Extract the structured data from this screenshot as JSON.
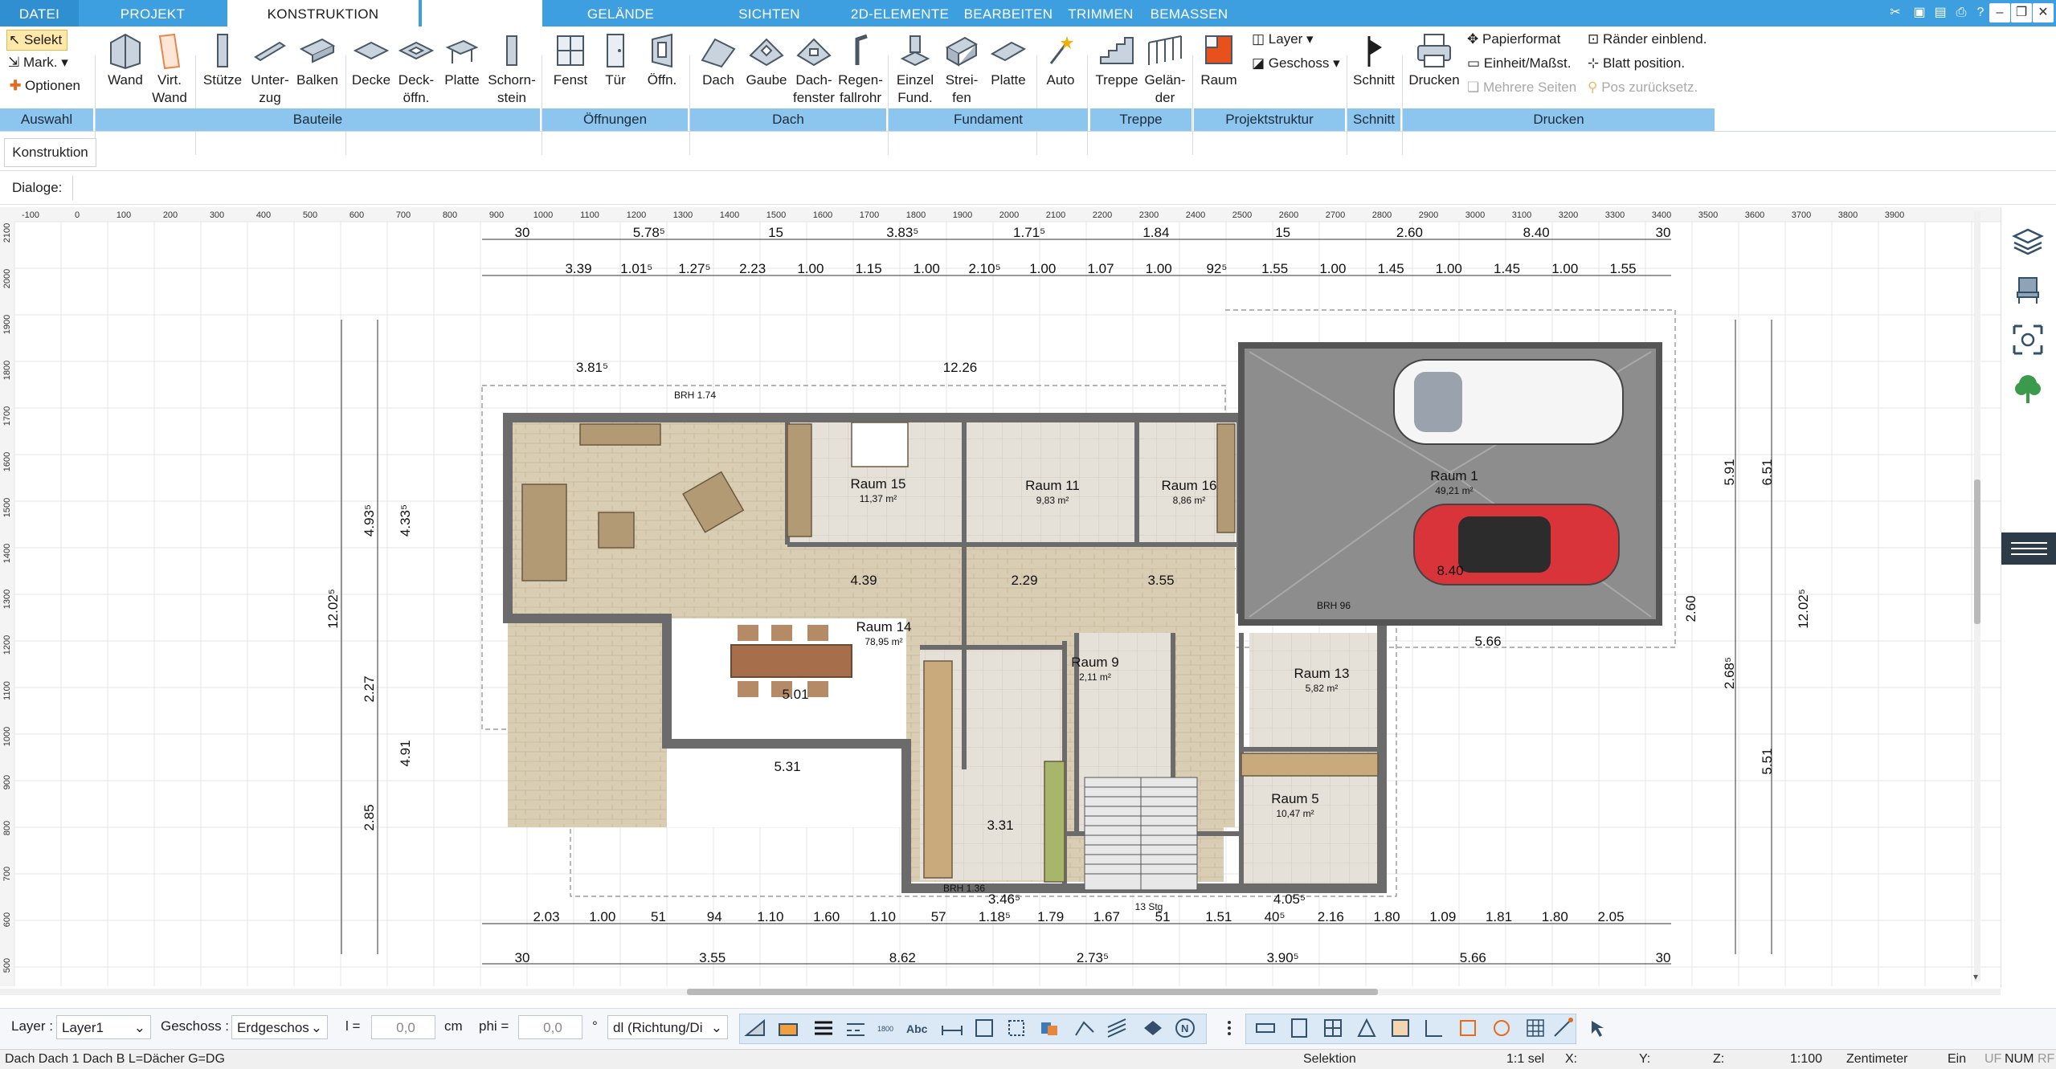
{
  "tabs": {
    "datei": "DATEI",
    "projekt": "PROJEKT",
    "konstruktion": "KONSTRUKTION",
    "gelaende": "GELÄNDE",
    "sichten": "SICHTEN",
    "elemente2d": "2D-ELEMENTE",
    "bearbeiten": "BEARBEITEN",
    "trimmen": "TRIMMEN",
    "bemassen": "BEMASSEN"
  },
  "ribbon": {
    "selekt": "Selekt",
    "mark": "Mark.",
    "optionen": "Optionen",
    "wand": "Wand",
    "virt_wand_1": "Virt.",
    "virt_wand_2": "Wand",
    "stuetze": "Stütze",
    "unterzug_1": "Unter-",
    "unterzug_2": "zug",
    "balken": "Balken",
    "decke": "Decke",
    "deckoeffn_1": "Deck-",
    "deckoeffn_2": "öffn.",
    "platte": "Platte",
    "schornstein_1": "Schorn-",
    "schornstein_2": "stein",
    "fenst": "Fenst",
    "tuer": "Tür",
    "oeffn": "Öffn.",
    "dach": "Dach",
    "gaube": "Gaube",
    "dachfenster_1": "Dach-",
    "dachfenster_2": "fenster",
    "regenfallrohr_1": "Regen-",
    "regenfallrohr_2": "fallrohr",
    "einzel_1": "Einzel",
    "einzel_2": "Fund.",
    "streifen_1": "Strei-",
    "streifen_2": "fen",
    "fund_platte": "Platte",
    "auto": "Auto",
    "treppe": "Treppe",
    "gelaender_1": "Gelän-",
    "gelaender_2": "der",
    "layer": "Layer",
    "geschoss": "Geschoss",
    "raum": "Raum",
    "schnitt": "Schnitt",
    "drucken": "Drucken",
    "papierformat": "Papierformat",
    "einheit": "Einheit/Maßst.",
    "mehrere_seiten": "Mehrere Seiten",
    "raender": "Ränder einblend.",
    "blatt": "Blatt position.",
    "pos_zurueck": "Pos zurücksetz."
  },
  "groups": {
    "auswahl": "Auswahl",
    "bauteile": "Bauteile",
    "oeffnungen": "Öffnungen",
    "dach": "Dach",
    "fundament": "Fundament",
    "treppe": "Treppe",
    "projektstruktur": "Projektstruktur",
    "schnitt": "Schnitt",
    "drucken": "Drucken"
  },
  "panel": {
    "konstruktion_tab": "Konstruktion",
    "dialoge": "Dialoge:"
  },
  "plan": {
    "rooms": [
      {
        "name": "Raum 1",
        "area": "49,21 m²"
      },
      {
        "name": "Raum 14",
        "area": "78,95 m²"
      },
      {
        "name": "Raum 15",
        "area": "11,37 m²"
      },
      {
        "name": "Raum 11",
        "area": "9,83 m²"
      },
      {
        "name": "Raum 16",
        "area": "8,86 m²"
      },
      {
        "name": "Raum 9",
        "area": "2,11 m²"
      },
      {
        "name": "Raum 13",
        "area": "5,82 m²"
      },
      {
        "name": "Raum 5",
        "area": "10,47 m²"
      }
    ],
    "top_dims_row1": [
      "30",
      "5.78⁵",
      "15",
      "3.83⁵",
      "1.71⁵",
      "1.84",
      "15",
      "2.60",
      "8.40",
      "30"
    ],
    "top_dims_row2": [
      "3.39",
      "1.01⁵",
      "1.27⁵",
      "2.23",
      "1.00",
      "1.15",
      "1.00",
      "2.10⁵",
      "1.00",
      "1.07",
      "1.00",
      "92⁵",
      "1.55",
      "1.00",
      "1.45",
      "1.00",
      "1.45",
      "1.00",
      "1.55"
    ],
    "bottom_dims_row1": [
      "2.03",
      "1.00",
      "51",
      "94",
      "1.10",
      "1.60",
      "1.10",
      "57",
      "1.18⁵",
      "1.79",
      "1.67",
      "51",
      "1.51",
      "40⁵",
      "2.16",
      "1.80",
      "1.09",
      "1.81",
      "1.80",
      "2.05"
    ],
    "bottom_dims_row2": [
      "30",
      "3.55",
      "8.62",
      "2.73⁵",
      "3.90⁵",
      "5.66",
      "30"
    ],
    "left_dims": [
      "12.02⁵",
      "4.93⁵",
      "4.33⁵",
      "2.27",
      "4.91",
      "2.85"
    ],
    "right_dims": [
      "12.02⁵",
      "5.91",
      "6.51",
      "5.51",
      "2.60",
      "2.68⁵"
    ],
    "inner_labels": [
      "12.26",
      "3.81⁵",
      "4.39",
      "2.29",
      "3.55",
      "5.31",
      "3.31",
      "5.66",
      "5.01",
      "8.40",
      "BRH 1.74",
      "BRH 96",
      "BRH 1.36",
      "3.46⁵",
      "4.05⁵",
      "13 Stg"
    ],
    "ruler_x": [
      "-100",
      "0",
      "100",
      "200",
      "300",
      "400",
      "500",
      "600",
      "700",
      "800",
      "900",
      "1000",
      "1100",
      "1200",
      "1300",
      "1400",
      "1500",
      "1600",
      "1700",
      "1800",
      "1900",
      "2000",
      "2100",
      "2200",
      "2300",
      "2400",
      "2500",
      "2600",
      "2700",
      "2800",
      "2900",
      "3000",
      "3100",
      "3200",
      "3300",
      "3400",
      "3500",
      "3600",
      "3700",
      "3800",
      "3900"
    ],
    "ruler_y": [
      "2100",
      "2000",
      "1900",
      "1800",
      "1700",
      "1600",
      "1500",
      "1400",
      "1300",
      "1200",
      "1100",
      "1000",
      "900",
      "800",
      "700",
      "600",
      "500"
    ]
  },
  "bottombar": {
    "layer_label": "Layer :",
    "layer_value": "Layer1",
    "geschoss_label": "Geschoss :",
    "geschoss_value": "Erdgeschos",
    "l_label": "l =",
    "l_value": "0,0",
    "cm": "cm",
    "phi_label": "phi =",
    "phi_value": "0,0",
    "deg": "°",
    "dl_value": "dl (Richtung/Di"
  },
  "statusbar": {
    "left": "Dach Dach 1 Dach B L=Dächer G=DG",
    "selektion": "Selektion",
    "scale_sel": "1:1 sel",
    "x": "X:",
    "y": "Y:",
    "z": "Z:",
    "scale": "1:100",
    "unit": "Zentimeter",
    "ein": "Ein",
    "uf": "UF",
    "num": "NUM",
    "rf": "RF"
  },
  "colors": {
    "accent": "#3d9fe0",
    "group_bar": "#8cc6ef",
    "floor": "#d8cdb6",
    "garage": "#8d8d8d",
    "wall": "#6b6b6b"
  }
}
